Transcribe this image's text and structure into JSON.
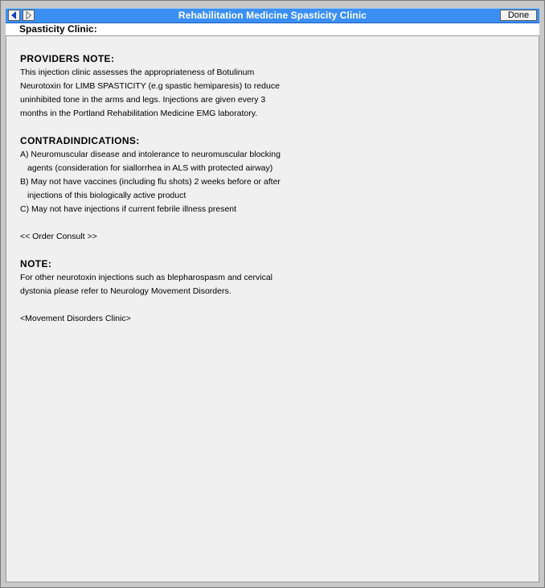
{
  "window": {
    "title": "Rehabilitation Medicine Spasticity Clinic",
    "done_label": "Done"
  },
  "header": {
    "label": "Spasticity Clinic:"
  },
  "providers_note": {
    "heading": "PROVIDERS NOTE:",
    "lines": [
      "This injection clinic assesses the appropriateness of Botulinum",
      "Neurotoxin for LIMB SPASTICITY (e.g spastic hemiparesis) to reduce",
      "uninhibited tone in the arms and legs. Injections are given every 3",
      "months in the Portland Rehabilitation Medicine EMG laboratory."
    ]
  },
  "contraindications": {
    "heading": "CONTRADINDICATIONS:",
    "lines": [
      "A) Neuromuscular disease and intolerance to neuromuscular blocking",
      "agents (consideration for siallorrhea in ALS with protected airway)",
      "B) May not have vaccines (including flu shots) 2 weeks before or after",
      "injections of this biologically active product",
      "C) May not have injections if current febrile illness present"
    ]
  },
  "order_consult_link": "<< Order Consult >>",
  "note": {
    "heading": "NOTE:",
    "lines": [
      "For other neurotoxin injections such as blepharospasm and cervical",
      "dystonia please refer to Neurology Movement Disorders."
    ]
  },
  "movement_disorders_link": "<Movement Disorders Clinic>",
  "icons": {
    "back": "back-arrow-icon",
    "forward": "forward-arrow-icon"
  },
  "colors": {
    "titlebar": "#3b8ff4",
    "content_background": "#f0f0f0"
  }
}
